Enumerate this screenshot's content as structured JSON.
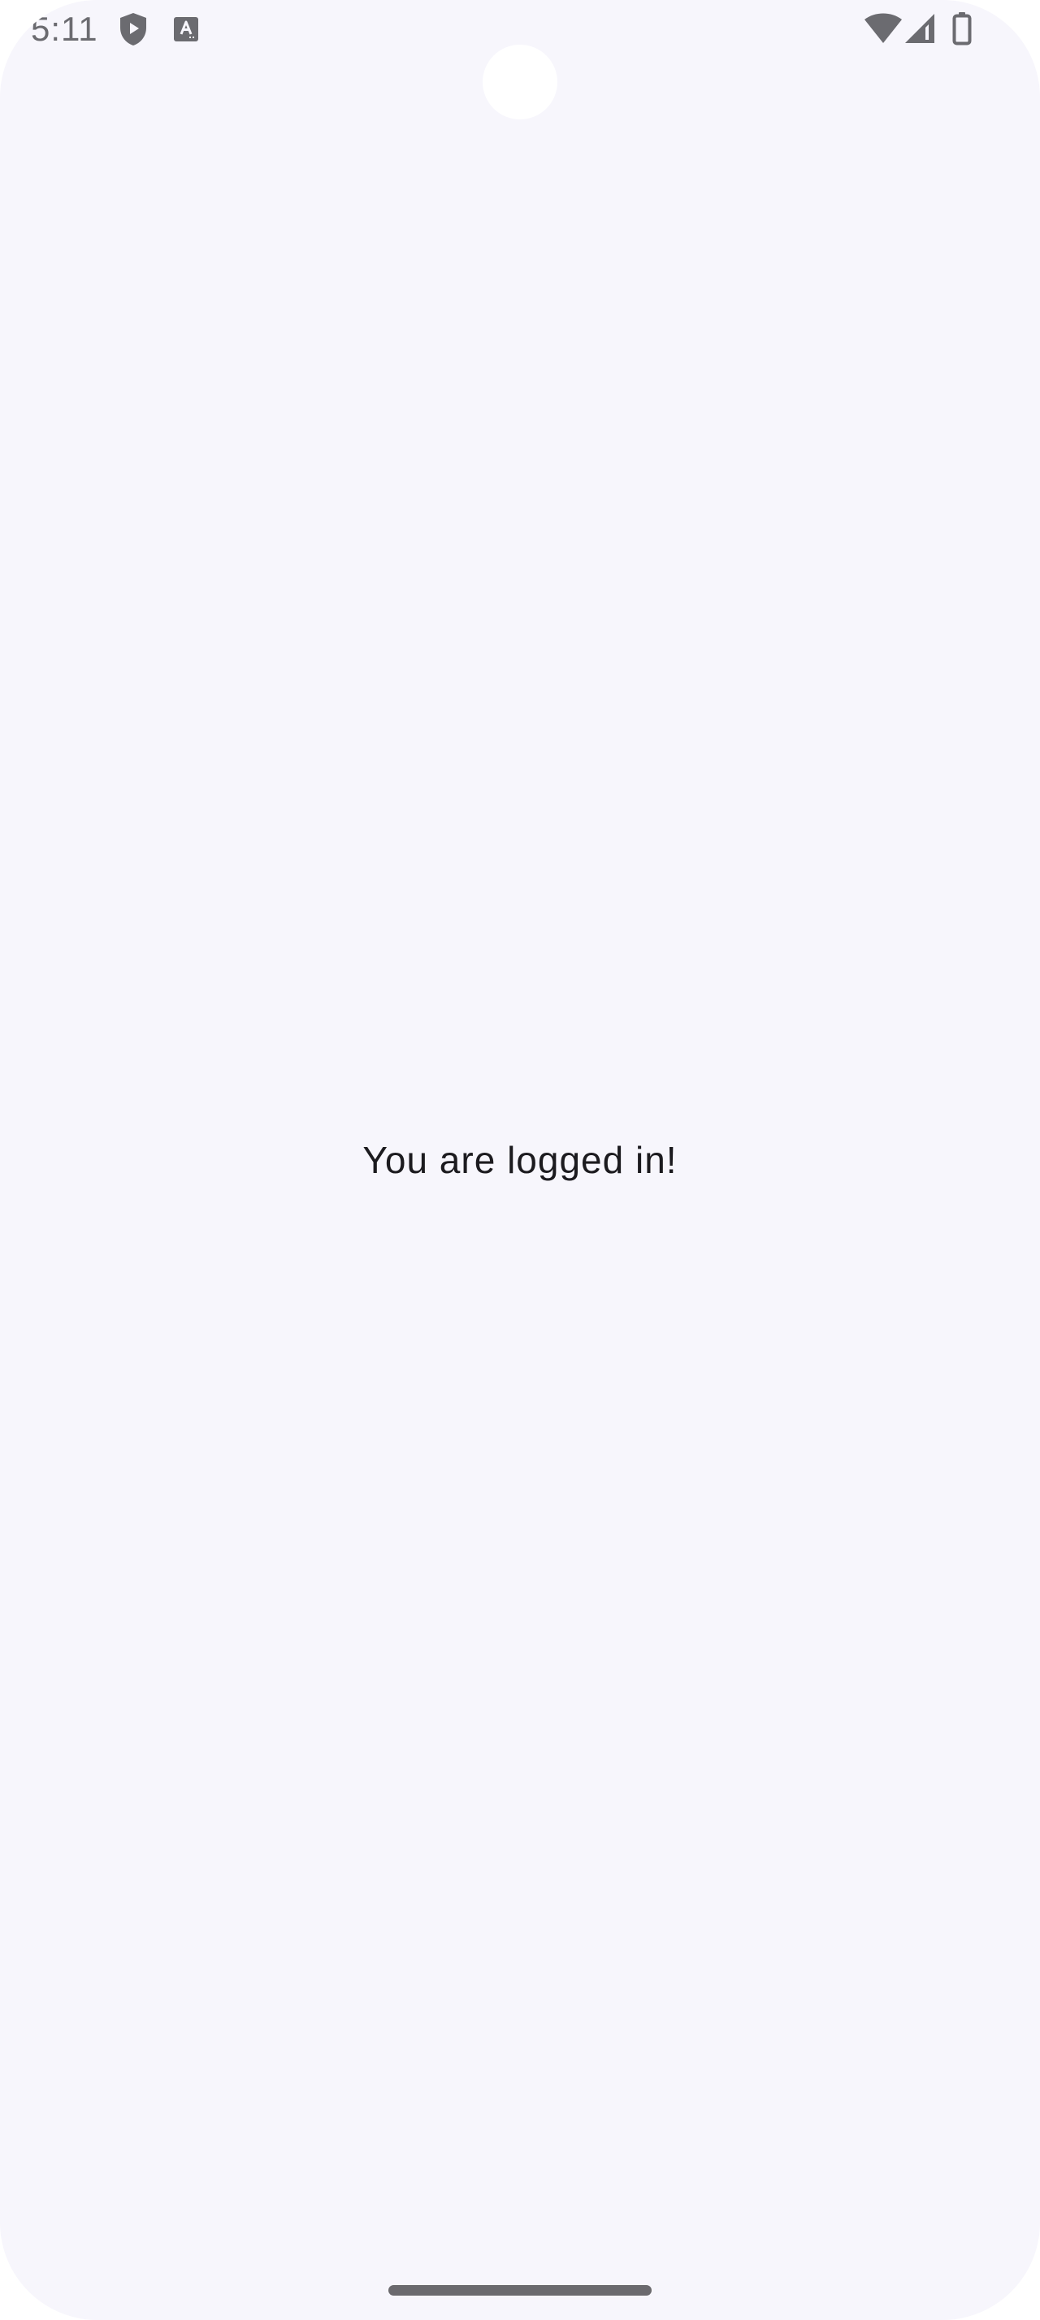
{
  "status_bar": {
    "time": "5:11",
    "left_icons": [
      "play-protect-shield-icon",
      "keyboard-a-icon"
    ],
    "right_icons": [
      "wifi-icon",
      "cell-signal-icon",
      "battery-icon"
    ],
    "icon_color": "#6b6b70"
  },
  "main": {
    "message": "You are logged in!"
  },
  "theme": {
    "background": "#f7f6fc",
    "text": "#1c1b1f"
  }
}
